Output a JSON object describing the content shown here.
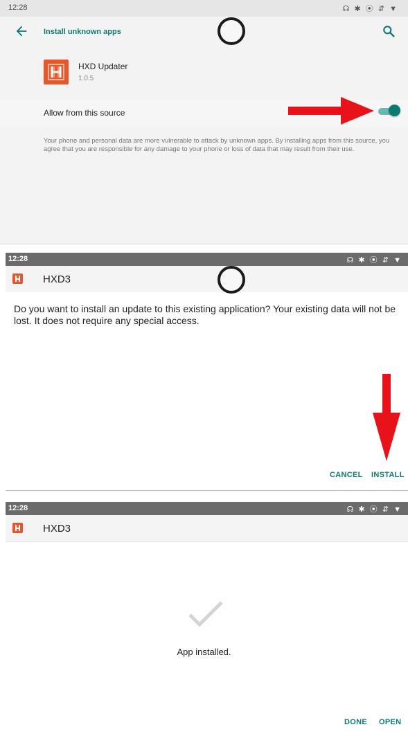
{
  "screen1": {
    "status": {
      "time": "12:28",
      "icons": "☊ ✱ ⦿ ⇵ ▼"
    },
    "toolbar": {
      "title": "Install unknown apps"
    },
    "app": {
      "name": "HXD Updater",
      "version": "1.0.5"
    },
    "setting": {
      "label": "Allow from this source",
      "enabled": true
    },
    "warning": "Your phone and personal data are more vulnerable to attack by unknown apps. By installing apps from this source, you agree that you are responsible for any damage to your phone or loss of data that may result from their use."
  },
  "screen2": {
    "status": {
      "time": "12:28",
      "icons": "☊ ✱ ⦿ ⇵ ▼"
    },
    "header": {
      "title": "HXD3"
    },
    "message": "Do you want to install an update to this existing application? Your existing data will not be lost. It does not require any special access.",
    "buttons": {
      "cancel": "CANCEL",
      "install": "INSTALL"
    }
  },
  "screen3": {
    "status": {
      "time": "12:28",
      "icons": "☊ ✱ ⦿ ⇵ ▼"
    },
    "header": {
      "title": "HXD3"
    },
    "message": "App installed.",
    "buttons": {
      "done": "DONE",
      "open": "OPEN"
    }
  },
  "colors": {
    "accent": "#0d7a72",
    "app_icon": "#e8562a",
    "arrow": "#e8121a",
    "status_dark": "#6b6b6b"
  },
  "icons": [
    "back-arrow-icon",
    "search-icon",
    "hxd-app-icon",
    "checkmark-icon",
    "home-circle-icon",
    "red-arrow-annotation"
  ]
}
